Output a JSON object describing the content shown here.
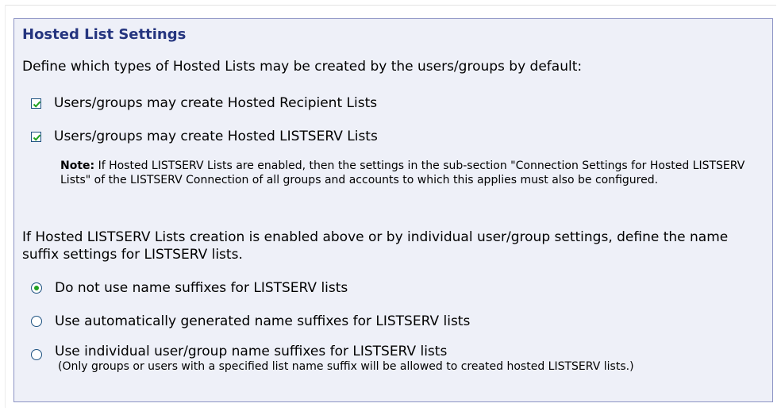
{
  "section": {
    "title": "Hosted List Settings",
    "intro": "Define which types of Hosted Lists may be created by the users/groups by default:"
  },
  "checkboxes": [
    {
      "label": "Users/groups may create Hosted Recipient Lists",
      "checked": true
    },
    {
      "label": "Users/groups may create Hosted LISTSERV Lists",
      "checked": true
    }
  ],
  "note": {
    "prefix": "Note:",
    "text": " If Hosted LISTSERV Lists are enabled, then the settings in the sub-section \"Connection Settings for Hosted LISTSERV Lists\" of the LISTSERV Connection of all groups and accounts to which this applies must also be configured."
  },
  "suffix_intro": "If Hosted LISTSERV Lists creation is enabled above or by individual user/group settings, define the name suffix settings for LISTSERV lists.",
  "radios": [
    {
      "label": "Do not use name suffixes for LISTSERV lists",
      "selected": true
    },
    {
      "label": "Use automatically generated name suffixes for LISTSERV lists",
      "selected": false
    },
    {
      "label": "Use individual user/group name suffixes for LISTSERV lists",
      "selected": false,
      "subtext": "(Only groups or users with a specified list name suffix will be allowed to created hosted LISTSERV lists.)"
    }
  ],
  "colors": {
    "title": "#25357f",
    "panel_bg": "#eef0f8",
    "panel_border": "#8c93c4",
    "check_mark": "#21a121"
  }
}
